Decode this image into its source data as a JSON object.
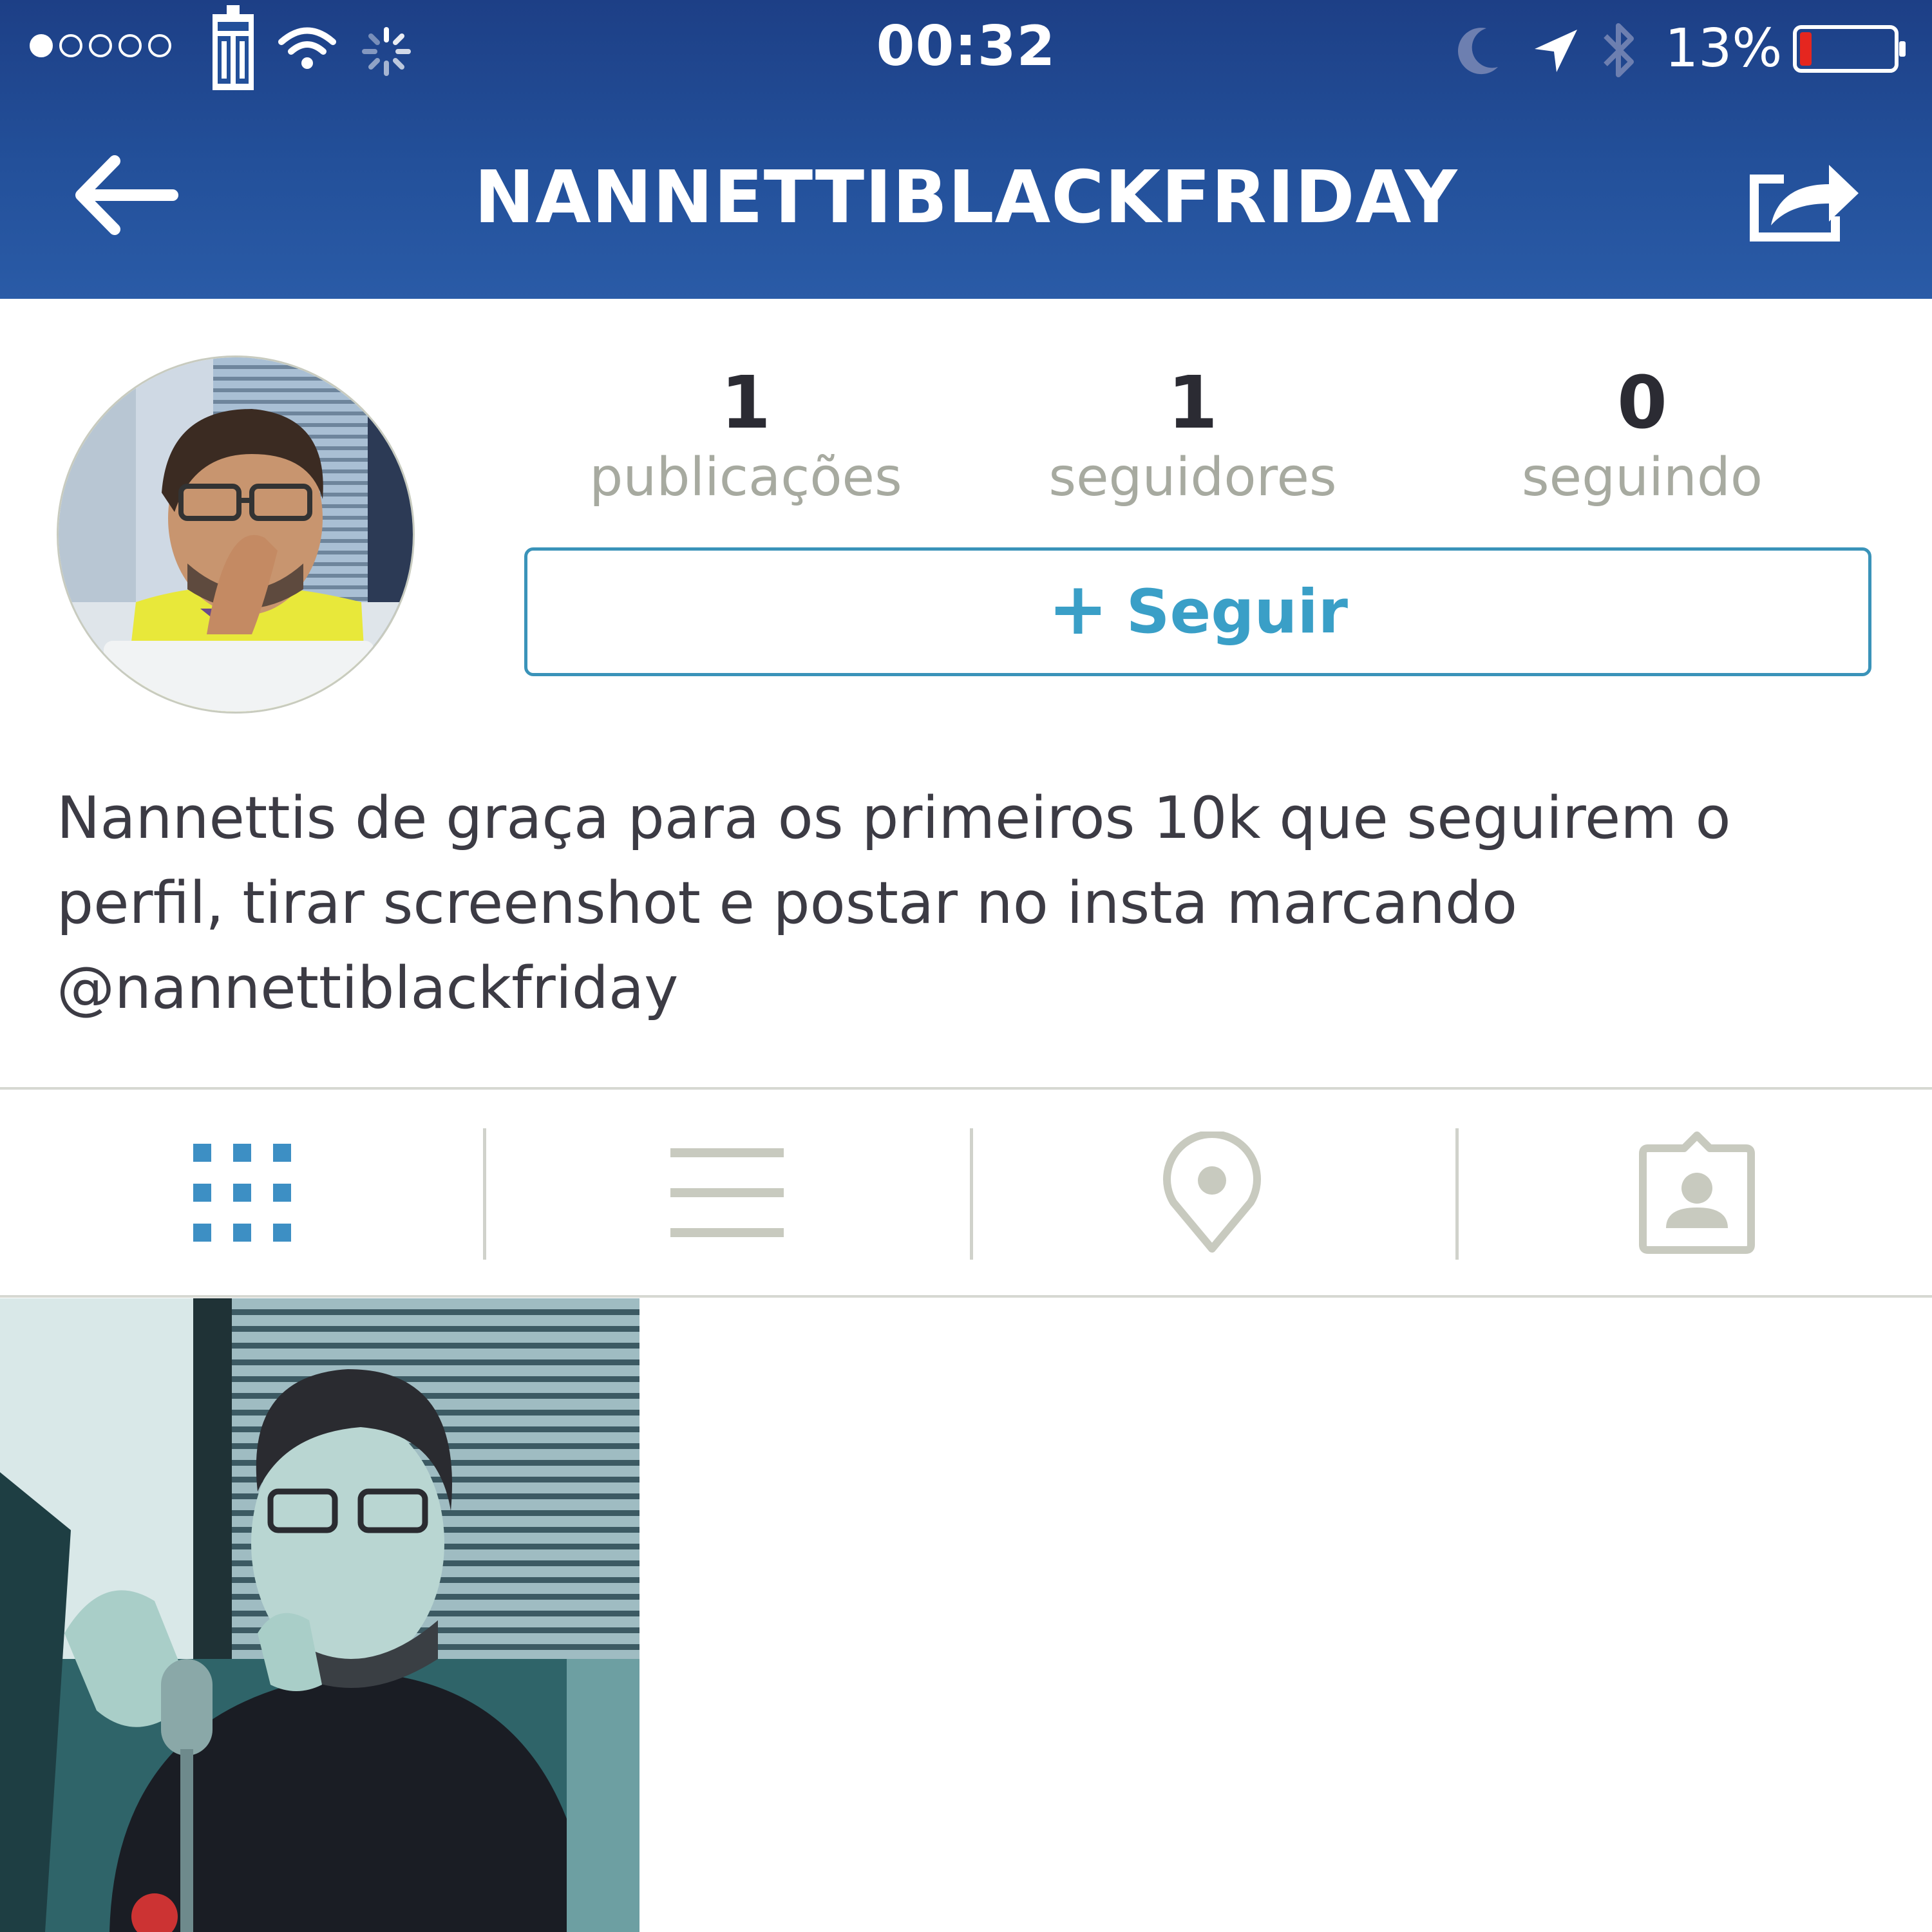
{
  "status_bar": {
    "time": "00:32",
    "battery_percent": "13%",
    "signal_dots_filled": 1,
    "signal_dots_total": 5,
    "battery_level": 0.13
  },
  "nav": {
    "title": "NANNETTIBLACKFRIDAY",
    "back_icon": "arrow-left-icon",
    "share_icon": "share-icon"
  },
  "profile": {
    "stats": [
      {
        "value": "1",
        "label": "publicações"
      },
      {
        "value": "1",
        "label": "seguidores"
      },
      {
        "value": "0",
        "label": "seguindo"
      }
    ],
    "follow_button": {
      "icon": "+",
      "label": "Seguir"
    },
    "bio": "Nannettis de graça para os primeiros 10k que seguirem o perfil, tirar screenshot e postar no insta marcando @nannettiblackfriday"
  },
  "tabs": [
    {
      "icon": "grid-icon",
      "selected": true
    },
    {
      "icon": "list-icon",
      "selected": false
    },
    {
      "icon": "map-pin-icon",
      "selected": false
    },
    {
      "icon": "tagged-photos-icon",
      "selected": false
    }
  ],
  "colors": {
    "header": "#23509a",
    "accent": "#3a9fc7",
    "active_tab": "#3d8fc4",
    "inactive_tab": "#c8cabf",
    "stat_label": "#a7aaa0",
    "battery_low": "#e5261f"
  }
}
